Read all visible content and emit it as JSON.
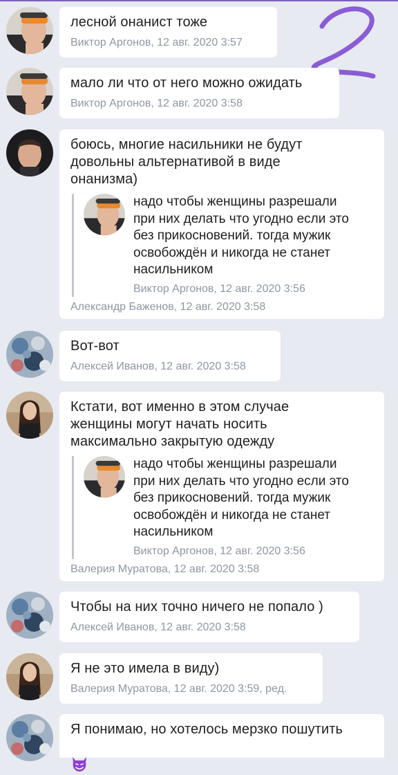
{
  "messages": [
    {
      "text": "лесной онанист тоже",
      "author_time": "Виктор Аргонов, 12 авг. 2020 3:57",
      "avatar": "viktor"
    },
    {
      "text": "мало ли что от него можно ожидать",
      "author_time": "Виктор Аргонов, 12 авг. 2020 3:58",
      "avatar": "viktor"
    },
    {
      "text": "боюсь, многие насильники не будут\nдовольны альтернативой в виде\nонанизма)",
      "quote": {
        "text": "надо чтобы женщины разрешали\nпри них делать что угодно если это\nбез прикосновений. тогда мужик\nосвобождён и никогда не станет\nнасильником",
        "author_time": "Виктор Аргонов, 12 авг. 2020 3:56"
      },
      "author_time": "Александр Баженов, 12 авг. 2020 3:58",
      "avatar": "alexander"
    },
    {
      "text": "Вот-вот",
      "author_time": "Алексей Иванов, 12 авг. 2020 3:58",
      "avatar": "alexey"
    },
    {
      "text": "Кстати, вот именно в этом случае\nженщины могут начать носить\nмаксимально закрытую одежду",
      "quote": {
        "text": "надо чтобы женщины разрешали\nпри них делать что угодно если это\nбез прикосновений. тогда мужик\nосвобождён и никогда не станет\nнасильником",
        "author_time": "Виктор Аргонов, 12 авг. 2020 3:56"
      },
      "author_time": "Валерия Муратова, 12 авг. 2020 3:58",
      "avatar": "valeria"
    },
    {
      "text": "Чтобы на них точно ничего не попало )",
      "author_time": "Алексей Иванов, 12 авг. 2020 3:58",
      "avatar": "alexey"
    },
    {
      "text": "Я не это имела в виду)",
      "author_time": "Валерия Муратова, 12 авг. 2020 3:59, ред.",
      "avatar": "valeria"
    },
    {
      "text": "Я понимаю, но хотелось мерзко пошутить",
      "emoji": "smiling-imp-emoji",
      "avatar": "alexey"
    }
  ],
  "colors": {
    "background": "#e7eaf0",
    "bubble": "#ffffff",
    "meta_text": "#8f96a1",
    "quote_bar": "#c3c8cf",
    "scribble": "#8a5cd6",
    "emoji": "#8e3fd1"
  }
}
